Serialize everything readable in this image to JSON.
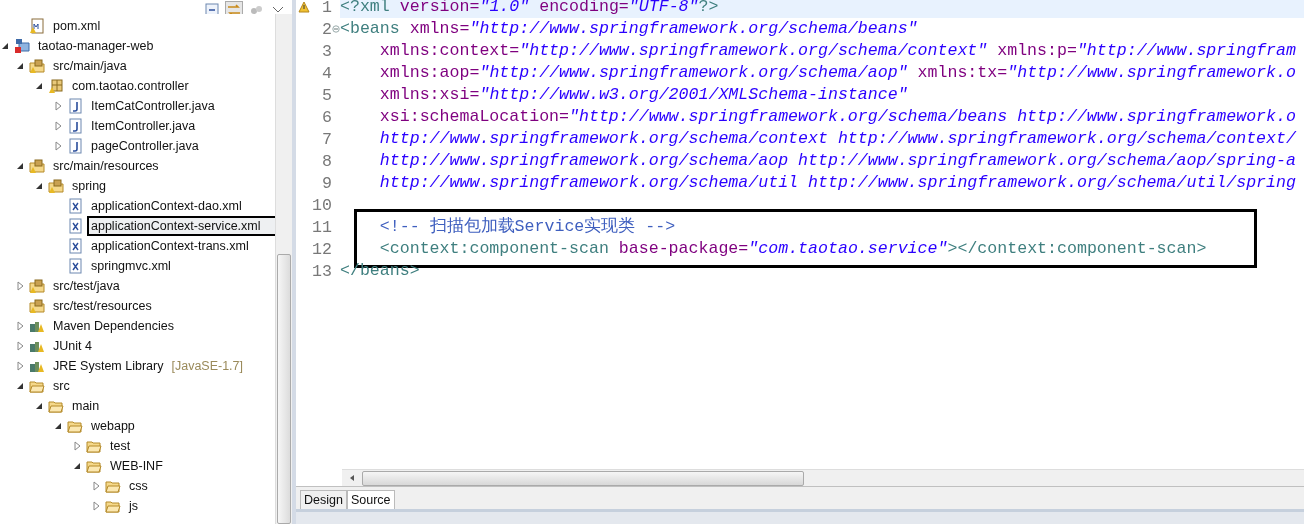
{
  "explorer": {
    "continued": [
      {
        "label": "pom.xml",
        "kind": "maven-file"
      }
    ],
    "items": [
      {
        "label": "taotao-manager-web",
        "kind": "project",
        "expanded": true,
        "children": [
          {
            "label": "src/main/java",
            "kind": "source-folder",
            "expanded": true,
            "children": [
              {
                "label": "com.taotao.controller",
                "kind": "package",
                "expanded": true,
                "children": [
                  {
                    "label": "ItemCatController.java",
                    "kind": "java-file",
                    "expanded": false
                  },
                  {
                    "label": "ItemController.java",
                    "kind": "java-file",
                    "expanded": false
                  },
                  {
                    "label": "pageController.java",
                    "kind": "java-file",
                    "expanded": false
                  }
                ]
              }
            ]
          },
          {
            "label": "src/main/resources",
            "kind": "source-folder",
            "expanded": true,
            "children": [
              {
                "label": "spring",
                "kind": "package-folder",
                "expanded": true,
                "children": [
                  {
                    "label": "applicationContext-dao.xml",
                    "kind": "xml-file"
                  },
                  {
                    "label": "applicationContext-service.xml",
                    "kind": "xml-file",
                    "highlighted": true
                  },
                  {
                    "label": "applicationContext-trans.xml",
                    "kind": "xml-file"
                  },
                  {
                    "label": "springmvc.xml",
                    "kind": "xml-file"
                  }
                ]
              }
            ]
          },
          {
            "label": "src/test/java",
            "kind": "source-folder",
            "expanded": false
          },
          {
            "label": "src/test/resources",
            "kind": "source-folder"
          },
          {
            "label": "Maven Dependencies",
            "kind": "library",
            "expanded": false
          },
          {
            "label": "JUnit 4",
            "kind": "library",
            "expanded": false
          },
          {
            "label": "JRE System Library",
            "kind": "library",
            "expanded": false,
            "decoration": "[JavaSE-1.7]"
          },
          {
            "label": "src",
            "kind": "folder",
            "expanded": true,
            "children": [
              {
                "label": "main",
                "kind": "folder",
                "expanded": true,
                "children": [
                  {
                    "label": "webapp",
                    "kind": "folder",
                    "expanded": true,
                    "children": [
                      {
                        "label": "test",
                        "kind": "folder",
                        "expanded": false
                      },
                      {
                        "label": "WEB-INF",
                        "kind": "folder",
                        "expanded": true,
                        "children": [
                          {
                            "label": "css",
                            "kind": "folder",
                            "expanded": false
                          },
                          {
                            "label": "js",
                            "kind": "folder",
                            "expanded": false
                          }
                        ]
                      }
                    ]
                  }
                ]
              }
            ]
          }
        ]
      }
    ]
  },
  "editor": {
    "lines": [
      {
        "number": "1",
        "kind": "warning",
        "current": true,
        "tokens": [
          {
            "kind": "tag",
            "text": "<?xml"
          },
          {
            "kind": "attr",
            "text": " version="
          },
          {
            "kind": "value",
            "text": "\"1.0\""
          },
          {
            "kind": "attr",
            "text": " encoding="
          },
          {
            "kind": "value",
            "text": "\"UTF-8\""
          },
          {
            "kind": "tag",
            "text": "?>"
          }
        ]
      },
      {
        "number": "2",
        "kind": "fold",
        "tokens": [
          {
            "kind": "tag",
            "text": "<beans"
          },
          {
            "kind": "attr",
            "text": " xmlns="
          },
          {
            "kind": "value",
            "text": "\"http://www.springframework.org/schema/beans\""
          }
        ]
      },
      {
        "number": "3",
        "tokens": [
          {
            "kind": "attr",
            "text": "    xmlns:context="
          },
          {
            "kind": "value",
            "text": "\"http://www.springframework.org/schema/context\""
          },
          {
            "kind": "attr",
            "text": " xmlns:p="
          },
          {
            "kind": "value",
            "text": "\"http://www.springfram"
          }
        ]
      },
      {
        "number": "4",
        "tokens": [
          {
            "kind": "attr",
            "text": "    xmlns:aop="
          },
          {
            "kind": "value",
            "text": "\"http://www.springframework.org/schema/aop\""
          },
          {
            "kind": "attr",
            "text": " xmlns:tx="
          },
          {
            "kind": "value",
            "text": "\"http://www.springframework.o"
          }
        ]
      },
      {
        "number": "5",
        "tokens": [
          {
            "kind": "attr",
            "text": "    xmlns:xsi="
          },
          {
            "kind": "value",
            "text": "\"http://www.w3.org/2001/XMLSchema-instance\""
          }
        ]
      },
      {
        "number": "6",
        "tokens": [
          {
            "kind": "attr",
            "text": "    xsi:schemaLocation="
          },
          {
            "kind": "value",
            "text": "\"http://www.springframework.org/schema/beans http://www.springframework.o"
          }
        ]
      },
      {
        "number": "7",
        "tokens": [
          {
            "kind": "value",
            "text": "    http://www.springframework.org/schema/context http://www.springframework.org/schema/context/"
          }
        ]
      },
      {
        "number": "8",
        "tokens": [
          {
            "kind": "value",
            "text": "    http://www.springframework.org/schema/aop http://www.springframework.org/schema/aop/spring-a"
          }
        ]
      },
      {
        "number": "9",
        "tokens": [
          {
            "kind": "value",
            "text": "    http://www.springframework.org/schema/util http://www.springframework.org/schema/util/spring"
          }
        ]
      },
      {
        "number": "10"
      },
      {
        "number": "11",
        "boxed": true,
        "tokens": [
          {
            "kind": "comment",
            "text": "    <!-- 扫描包加载Service实现类 -->"
          }
        ]
      },
      {
        "number": "12",
        "boxed": true,
        "tokens": [
          {
            "kind": "tag",
            "text": "    <context:component-scan"
          },
          {
            "kind": "attr",
            "text": " base-package="
          },
          {
            "kind": "value",
            "text": "\"com.taotao.service\""
          },
          {
            "kind": "tag",
            "text": "></context:component-scan>"
          }
        ]
      },
      {
        "number": "13",
        "tokens": [
          {
            "kind": "tag",
            "text": "</beans>"
          }
        ]
      }
    ]
  },
  "tabs": [
    {
      "label": "Design",
      "selected": false
    },
    {
      "label": "Source",
      "selected": true
    }
  ]
}
